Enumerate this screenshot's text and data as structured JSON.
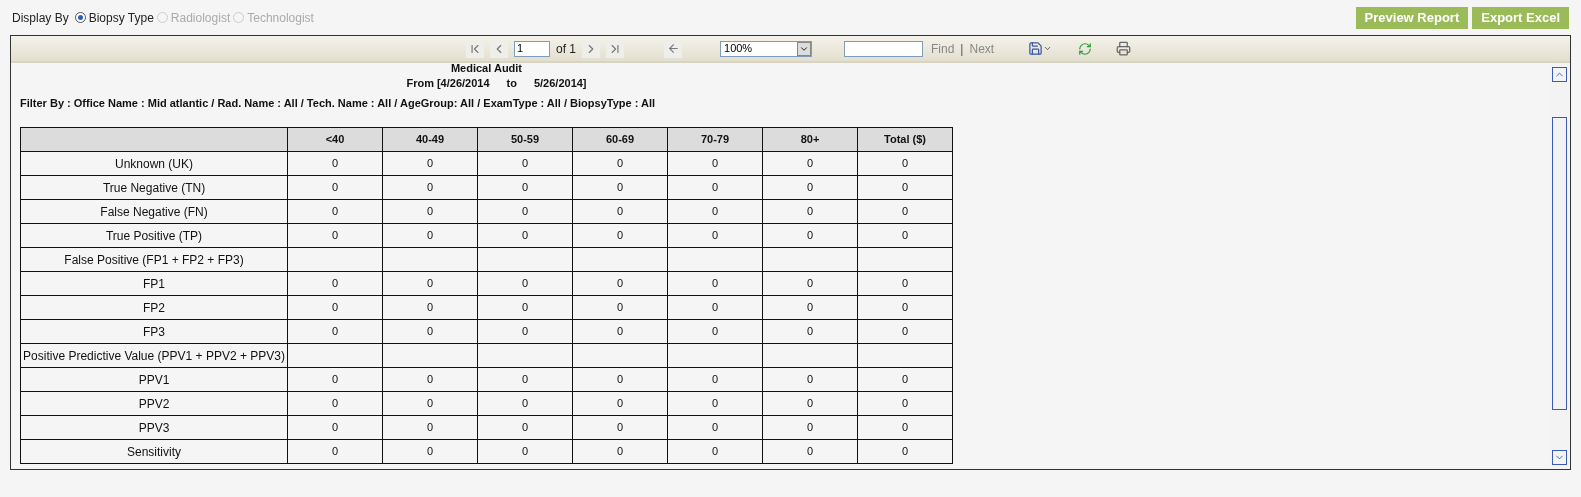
{
  "display_by": {
    "label": "Display By",
    "options": [
      {
        "label": "Biopsy Type",
        "selected": true,
        "disabled": false
      },
      {
        "label": "Radiologist",
        "selected": false,
        "disabled": true
      },
      {
        "label": "Technologist",
        "selected": false,
        "disabled": true
      }
    ]
  },
  "buttons": [
    "Preview Report",
    "Export Excel"
  ],
  "toolbar": {
    "page": "1",
    "page_total": "of 1",
    "zoom": "100%",
    "find": "Find",
    "separator": "|",
    "next": "Next"
  },
  "report": {
    "title": "Medical Audit",
    "from_label": "From",
    "from": "[4/26/2014",
    "to_label": "to",
    "to": "5/26/2014]",
    "filter": "Filter By : Office Name : Mid atlantic / Rad. Name : All / Tech. Name : All / AgeGroup: All / ExamType : All / BiopsyType : All"
  },
  "table": {
    "columns": [
      "<40",
      "40-49",
      "50-59",
      "60-69",
      "70-79",
      "80+",
      "Total ($)"
    ],
    "rows": [
      {
        "kind": "data",
        "label": "Unknown (UK)",
        "values": [
          "0",
          "0",
          "0",
          "0",
          "0",
          "0",
          "0"
        ]
      },
      {
        "kind": "data",
        "label": "True Negative (TN)",
        "values": [
          "0",
          "0",
          "0",
          "0",
          "0",
          "0",
          "0"
        ]
      },
      {
        "kind": "data",
        "label": "False Negative (FN)",
        "values": [
          "0",
          "0",
          "0",
          "0",
          "0",
          "0",
          "0"
        ]
      },
      {
        "kind": "data",
        "label": "True Positive (TP)",
        "values": [
          "0",
          "0",
          "0",
          "0",
          "0",
          "0",
          "0"
        ]
      },
      {
        "kind": "group",
        "label": "False Positive (FP1 + FP2 + FP3)"
      },
      {
        "kind": "data",
        "label": "FP1",
        "values": [
          "0",
          "0",
          "0",
          "0",
          "0",
          "0",
          "0"
        ]
      },
      {
        "kind": "data",
        "label": "FP2",
        "values": [
          "0",
          "0",
          "0",
          "0",
          "0",
          "0",
          "0"
        ]
      },
      {
        "kind": "data",
        "label": "FP3",
        "values": [
          "0",
          "0",
          "0",
          "0",
          "0",
          "0",
          "0"
        ]
      },
      {
        "kind": "group",
        "label": "Positive Predictive Value (PPV1 + PPV2 + PPV3)"
      },
      {
        "kind": "data",
        "label": "PPV1",
        "values": [
          "0",
          "0",
          "0",
          "0",
          "0",
          "0",
          "0"
        ]
      },
      {
        "kind": "data",
        "label": "PPV2",
        "values": [
          "0",
          "0",
          "0",
          "0",
          "0",
          "0",
          "0"
        ]
      },
      {
        "kind": "data",
        "label": "PPV3",
        "values": [
          "0",
          "0",
          "0",
          "0",
          "0",
          "0",
          "0"
        ]
      },
      {
        "kind": "data",
        "label": "Sensitivity",
        "values": [
          "0",
          "0",
          "0",
          "0",
          "0",
          "0",
          "0"
        ]
      }
    ]
  }
}
